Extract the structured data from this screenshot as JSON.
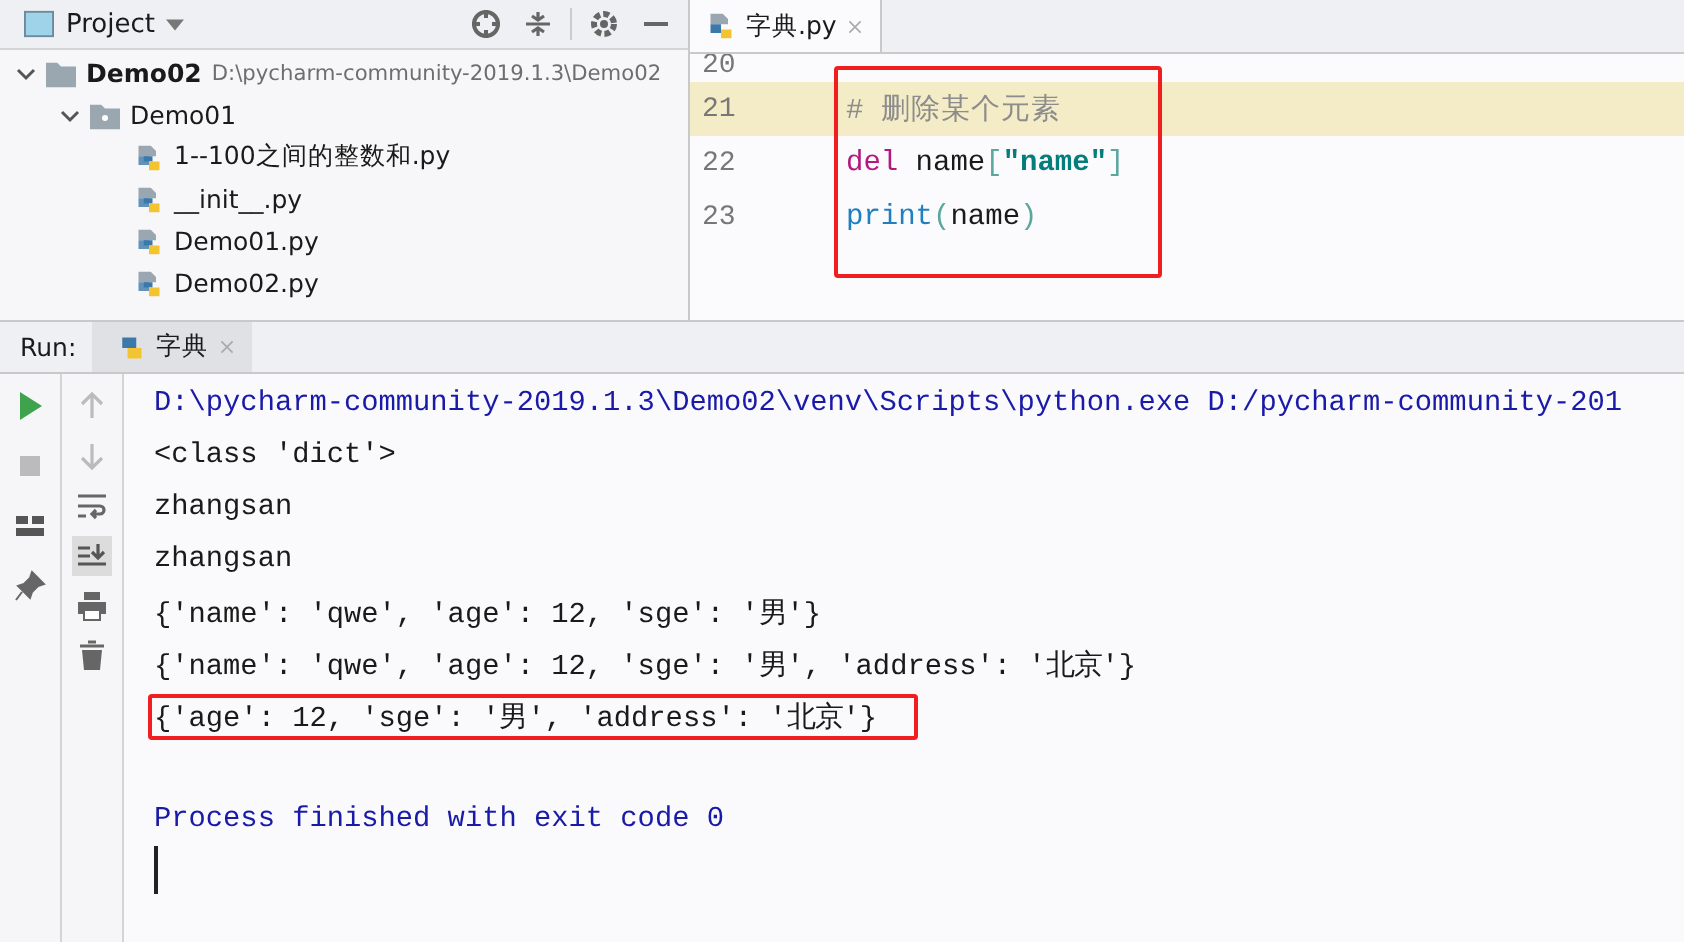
{
  "project_panel": {
    "title": "Project",
    "tree": [
      {
        "name": "Demo02",
        "path": "D:\\pycharm-community-2019.1.3\\Demo02",
        "kind": "project",
        "expanded": true,
        "children": [
          {
            "name": "Demo01",
            "kind": "folder",
            "expanded": true,
            "children": [
              {
                "name": "1--100之间的整数和.py",
                "kind": "python"
              },
              {
                "name": "__init__.py",
                "kind": "python"
              },
              {
                "name": "Demo01.py",
                "kind": "python"
              },
              {
                "name": "Demo02.py",
                "kind": "python"
              }
            ]
          }
        ]
      }
    ]
  },
  "editor": {
    "tabs": [
      {
        "label": "字典.py",
        "selected": true
      }
    ],
    "lines": [
      {
        "number": "20",
        "current": false
      },
      {
        "number": "21",
        "current": true,
        "tokens": [
          {
            "kind": "comment",
            "text": "# 删除某个元素"
          }
        ]
      },
      {
        "number": "22",
        "current": false,
        "tokens": [
          {
            "kind": "keyword",
            "text": "del"
          },
          {
            "kind": "plain",
            "text": " name"
          },
          {
            "kind": "bracket",
            "text": "["
          },
          {
            "kind": "string",
            "text": "\"name\""
          },
          {
            "kind": "bracket",
            "text": "]"
          }
        ]
      },
      {
        "number": "23",
        "current": false,
        "tokens": [
          {
            "kind": "builtin",
            "text": "print"
          },
          {
            "kind": "bracket",
            "text": "("
          },
          {
            "kind": "plain",
            "text": "name"
          },
          {
            "kind": "bracket",
            "text": ")"
          }
        ]
      }
    ],
    "highlighted": true
  },
  "run_panel": {
    "label": "Run:",
    "tabs": [
      {
        "label": "字典",
        "selected": true
      }
    ],
    "console": [
      {
        "kind": "command",
        "text": "D:\\pycharm-community-2019.1.3\\Demo02\\venv\\Scripts\\python.exe D:/pycharm-community-201",
        "highlighted": false
      },
      {
        "kind": "output",
        "text": "<class 'dict'>",
        "highlighted": false
      },
      {
        "kind": "output",
        "text": "zhangsan",
        "highlighted": false
      },
      {
        "kind": "output",
        "text": "zhangsan",
        "highlighted": false
      },
      {
        "kind": "output",
        "text": "{'name': 'qwe', 'age': 12, 'sge': '男'}",
        "highlighted": false
      },
      {
        "kind": "output",
        "text": "{'name': 'qwe', 'age': 12, 'sge': '男', 'address': '北京'}",
        "highlighted": false
      },
      {
        "kind": "output",
        "text": "{'age': 12, 'sge': '男', 'address': '北京'}",
        "highlighted": true
      },
      {
        "kind": "blank"
      },
      {
        "kind": "system",
        "text": "Process finished with exit code 0",
        "highlighted": false
      }
    ]
  }
}
